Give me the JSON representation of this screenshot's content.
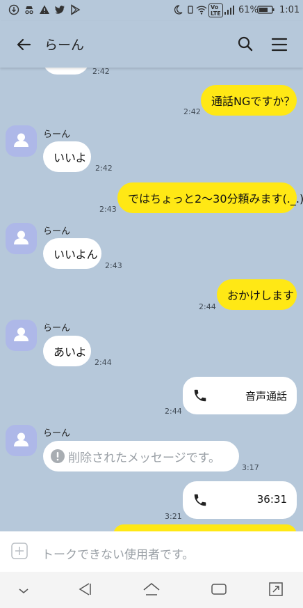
{
  "status_bar": {
    "battery": "61%",
    "time": "1:01",
    "volte": "Vo\nLTE"
  },
  "header": {
    "title": "らーん"
  },
  "chat": {
    "contact_name": "らーん",
    "messages": [
      {
        "dir": "in",
        "text": "",
        "time": "2:42"
      },
      {
        "dir": "out",
        "text": "通話NGですか？",
        "time": "2:42"
      },
      {
        "dir": "in",
        "text": "いいよ",
        "time": "2:42"
      },
      {
        "dir": "out",
        "text": "ではちょっと2〜30分頼みます(._.)",
        "time": "2:43"
      },
      {
        "dir": "in",
        "text": "いいよん",
        "time": "2:43"
      },
      {
        "dir": "out",
        "text": "おかけします",
        "time": "2:44"
      },
      {
        "dir": "in",
        "text": "あいよ",
        "time": "2:44"
      },
      {
        "dir": "out",
        "type": "call",
        "text": "音声通話",
        "time": "2:44"
      },
      {
        "dir": "in",
        "type": "deleted",
        "text": "削除されたメッセージです。",
        "time": "3:17"
      },
      {
        "dir": "out",
        "type": "call",
        "text": "36:31",
        "time": "3:21"
      }
    ]
  },
  "input": {
    "placeholder": "トークできない使用者です。"
  },
  "colors": {
    "background": "#b6c8da",
    "outgoing": "#ffe815",
    "incoming": "#ffffff",
    "avatar": "#aeb8e8"
  }
}
